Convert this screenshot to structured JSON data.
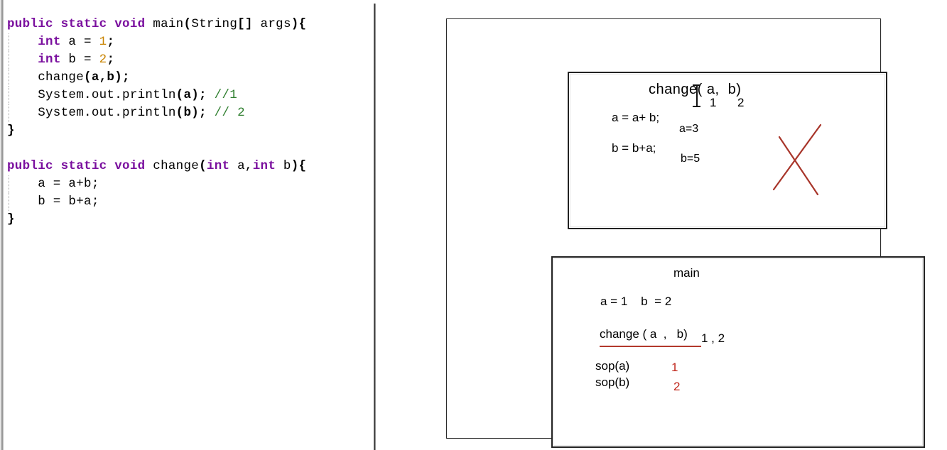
{
  "editor": {
    "language": "java",
    "colors": {
      "keyword": "#7a0f9e",
      "number": "#c98400",
      "comment": "#2f7f2f",
      "identifier": "#000000"
    },
    "lines": [
      {
        "indent": false,
        "tokens": [
          {
            "t": "public",
            "c": "kw"
          },
          {
            "t": " ",
            "c": "plain"
          },
          {
            "t": "static",
            "c": "kw"
          },
          {
            "t": " ",
            "c": "plain"
          },
          {
            "t": "void",
            "c": "kw"
          },
          {
            "t": " ",
            "c": "plain"
          },
          {
            "t": "main",
            "c": "id"
          },
          {
            "t": "(",
            "c": "punc"
          },
          {
            "t": "String",
            "c": "id"
          },
          {
            "t": "[]",
            "c": "punc"
          },
          {
            "t": " args",
            "c": "id"
          },
          {
            "t": "){",
            "c": "punc"
          }
        ]
      },
      {
        "indent": true,
        "tokens": [
          {
            "t": "    ",
            "c": "plain"
          },
          {
            "t": "int",
            "c": "kw"
          },
          {
            "t": " a ",
            "c": "id"
          },
          {
            "t": "=",
            "c": "id"
          },
          {
            "t": " ",
            "c": "plain"
          },
          {
            "t": "1",
            "c": "num"
          },
          {
            "t": ";",
            "c": "punc"
          }
        ]
      },
      {
        "indent": true,
        "tokens": [
          {
            "t": "    ",
            "c": "plain"
          },
          {
            "t": "int",
            "c": "kw"
          },
          {
            "t": " b ",
            "c": "id"
          },
          {
            "t": "=",
            "c": "id"
          },
          {
            "t": " ",
            "c": "plain"
          },
          {
            "t": "2",
            "c": "num"
          },
          {
            "t": ";",
            "c": "punc"
          }
        ]
      },
      {
        "indent": true,
        "tokens": [
          {
            "t": "    change",
            "c": "id"
          },
          {
            "t": "(a,b);",
            "c": "punc"
          }
        ]
      },
      {
        "indent": true,
        "tokens": [
          {
            "t": "    System.out.println",
            "c": "id"
          },
          {
            "t": "(a);",
            "c": "punc"
          },
          {
            "t": " ",
            "c": "plain"
          },
          {
            "t": "//1",
            "c": "cmt"
          }
        ]
      },
      {
        "indent": true,
        "tokens": [
          {
            "t": "    System.out.println",
            "c": "id"
          },
          {
            "t": "(b);",
            "c": "punc"
          },
          {
            "t": " ",
            "c": "plain"
          },
          {
            "t": "// 2",
            "c": "cmt"
          }
        ]
      },
      {
        "indent": false,
        "tokens": [
          {
            "t": "}",
            "c": "punc"
          }
        ]
      },
      {
        "indent": false,
        "tokens": []
      },
      {
        "indent": false,
        "tokens": [
          {
            "t": "public",
            "c": "kw"
          },
          {
            "t": " ",
            "c": "plain"
          },
          {
            "t": "static",
            "c": "kw"
          },
          {
            "t": " ",
            "c": "plain"
          },
          {
            "t": "void",
            "c": "kw"
          },
          {
            "t": " ",
            "c": "plain"
          },
          {
            "t": "change",
            "c": "id"
          },
          {
            "t": "(",
            "c": "punc"
          },
          {
            "t": "int",
            "c": "kw"
          },
          {
            "t": " a,",
            "c": "id"
          },
          {
            "t": "int",
            "c": "kw"
          },
          {
            "t": " b",
            "c": "id"
          },
          {
            "t": "){",
            "c": "punc"
          }
        ]
      },
      {
        "indent": true,
        "tokens": [
          {
            "t": "    a = a+b;",
            "c": "id"
          }
        ]
      },
      {
        "indent": true,
        "tokens": [
          {
            "t": "    b = b+a;",
            "c": "id"
          }
        ]
      },
      {
        "indent": false,
        "tokens": [
          {
            "t": "}",
            "c": "punc"
          }
        ]
      }
    ]
  },
  "whiteboard": {
    "change_frame": {
      "title": "change( a,  b)",
      "arg_sub_1": "1",
      "arg_sub_2": "2",
      "statement_a": "a = a+ b;",
      "value_a": "a=3",
      "statement_b": "b = b+a;",
      "value_b": "b=5",
      "cross_out_color": "#a8352a",
      "cross_out_name": "red-x-strike"
    },
    "main_frame": {
      "title": "main",
      "vars": "a = 1    b  = 2",
      "call": "change ( a  ,   b)",
      "call_args": "1 , 2",
      "call_underline_color": "#b2392c",
      "print_a_label": "sop(a)",
      "print_a_value": "1",
      "print_b_label": "sop(b)",
      "print_b_value": "2",
      "output_color": "#c0261b"
    }
  }
}
